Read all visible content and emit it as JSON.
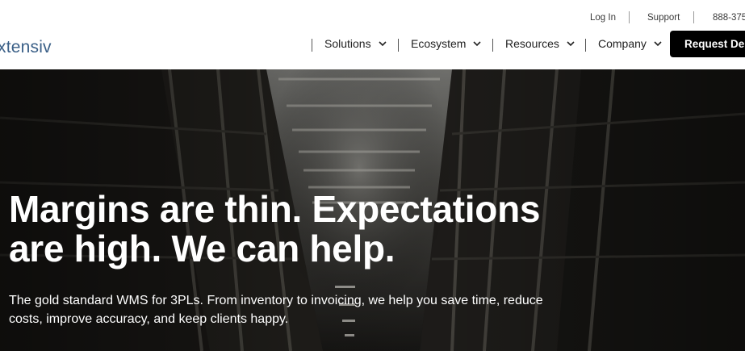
{
  "utility": {
    "login_label": "Log In",
    "support_label": "Support",
    "phone_label": "888-375"
  },
  "nav": {
    "logo_text": "xtensiv",
    "items": [
      {
        "label": "Solutions"
      },
      {
        "label": "Ecosystem"
      },
      {
        "label": "Resources"
      },
      {
        "label": "Company"
      }
    ],
    "cta_label": "Request Dem"
  },
  "hero": {
    "headline_line1": "Margins are thin. Expectations",
    "headline_line2": "are high. We can help.",
    "subtext_line1": "The gold standard WMS for 3PLs. From inventory to invoicing, we help you save time, reduce",
    "subtext_line2": "costs, improve accuracy, and keep clients happy."
  },
  "colors": {
    "logo": "#3a5f87",
    "cta_bg": "#000000",
    "hero_text": "#ffffff"
  },
  "icons": {
    "nav_dropdown": "chevron-down-icon"
  }
}
